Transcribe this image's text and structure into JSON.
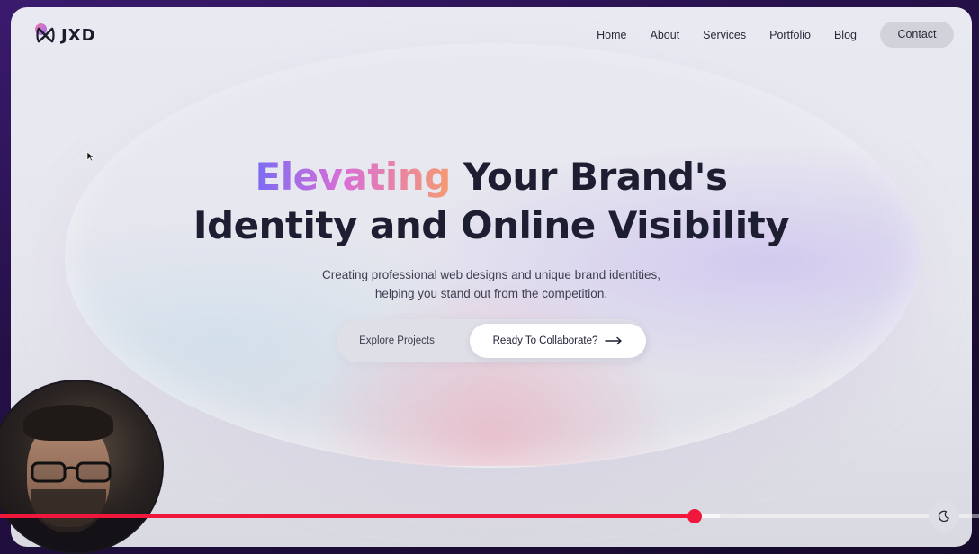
{
  "brand": {
    "logo_text": "JXD"
  },
  "nav": {
    "items": [
      {
        "label": "Home"
      },
      {
        "label": "About"
      },
      {
        "label": "Services"
      },
      {
        "label": "Portfolio"
      },
      {
        "label": "Blog"
      }
    ],
    "contact_label": "Contact"
  },
  "hero": {
    "title_highlight": "Elevating",
    "title_rest_line1": " Your Brand's",
    "title_line2": "Identity and Online Visibility",
    "subtitle_line1": "Creating professional web designs and unique brand identities,",
    "subtitle_line2": "helping you stand out from the competition.",
    "cta_secondary": "Explore Projects",
    "cta_primary": "Ready To Collaborate?"
  },
  "video_player": {
    "progress_percent": 71,
    "buffered_percent": 73.5
  },
  "icons": {
    "logo": "jxd-logo-icon",
    "cta_arrow": "arrow-right-icon",
    "theme_toggle": "moon-icon",
    "cursor": "mouse-cursor-icon"
  },
  "colors": {
    "accent_gradient_start": "#7b6cf3",
    "accent_gradient_mid": "#d96fd6",
    "accent_gradient_end": "#f59a72",
    "heading": "#1d1e32",
    "progress": "#f0163c"
  }
}
